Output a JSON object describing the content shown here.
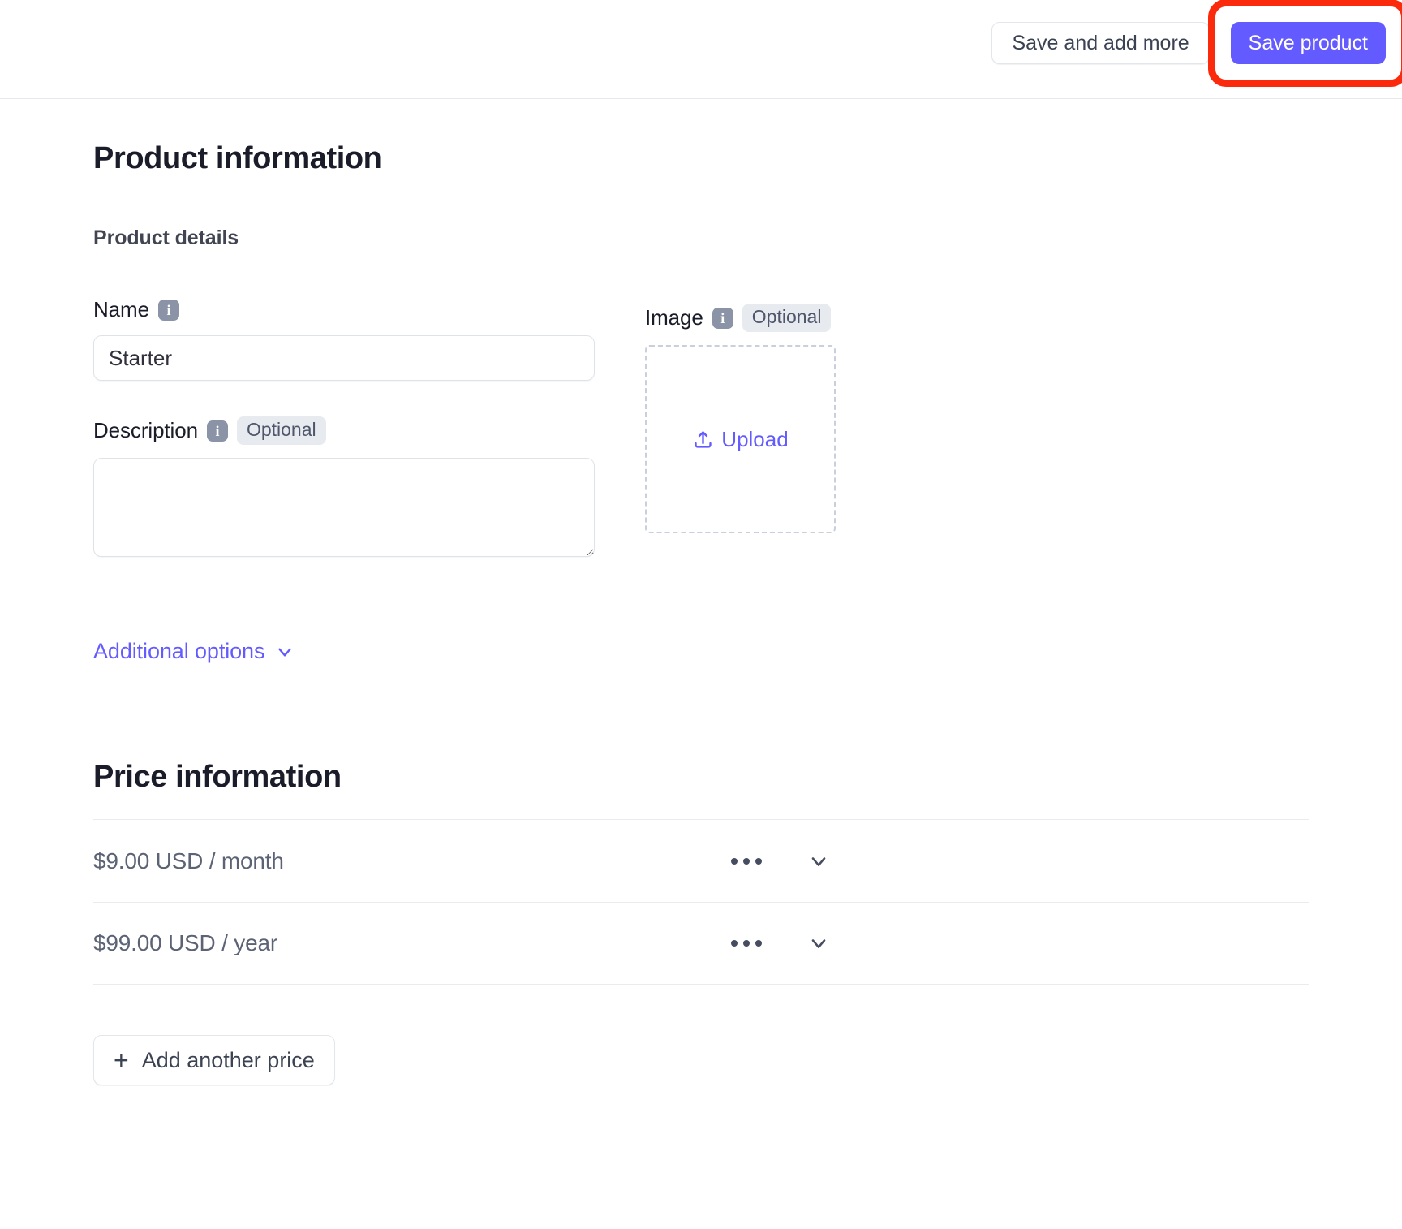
{
  "topbar": {
    "save_and_add_more_label": "Save and add more",
    "save_product_label": "Save product",
    "primary_color": "#635bff",
    "highlight_color": "#fc2a0c"
  },
  "product_information": {
    "heading": "Product information",
    "subheading": "Product details",
    "name_field": {
      "label": "Name",
      "info_icon": "info-icon",
      "value": "Starter",
      "placeholder": ""
    },
    "description_field": {
      "label": "Description",
      "info_icon": "info-icon",
      "badge": "Optional",
      "value": "",
      "placeholder": ""
    },
    "image_field": {
      "label": "Image",
      "info_icon": "info-icon",
      "badge": "Optional",
      "upload_label": "Upload",
      "upload_icon": "upload-icon"
    },
    "additional_options": {
      "label": "Additional options",
      "chevron_icon": "chevron-down-icon"
    }
  },
  "price_information": {
    "heading": "Price information",
    "rows": [
      {
        "label": "$9.00 USD / month",
        "menu_icon": "ellipsis-icon",
        "expand_icon": "chevron-down-icon"
      },
      {
        "label": "$99.00 USD / year",
        "menu_icon": "ellipsis-icon",
        "expand_icon": "chevron-down-icon"
      }
    ],
    "add_price_button": {
      "label": "Add another price",
      "icon": "plus-icon"
    }
  }
}
